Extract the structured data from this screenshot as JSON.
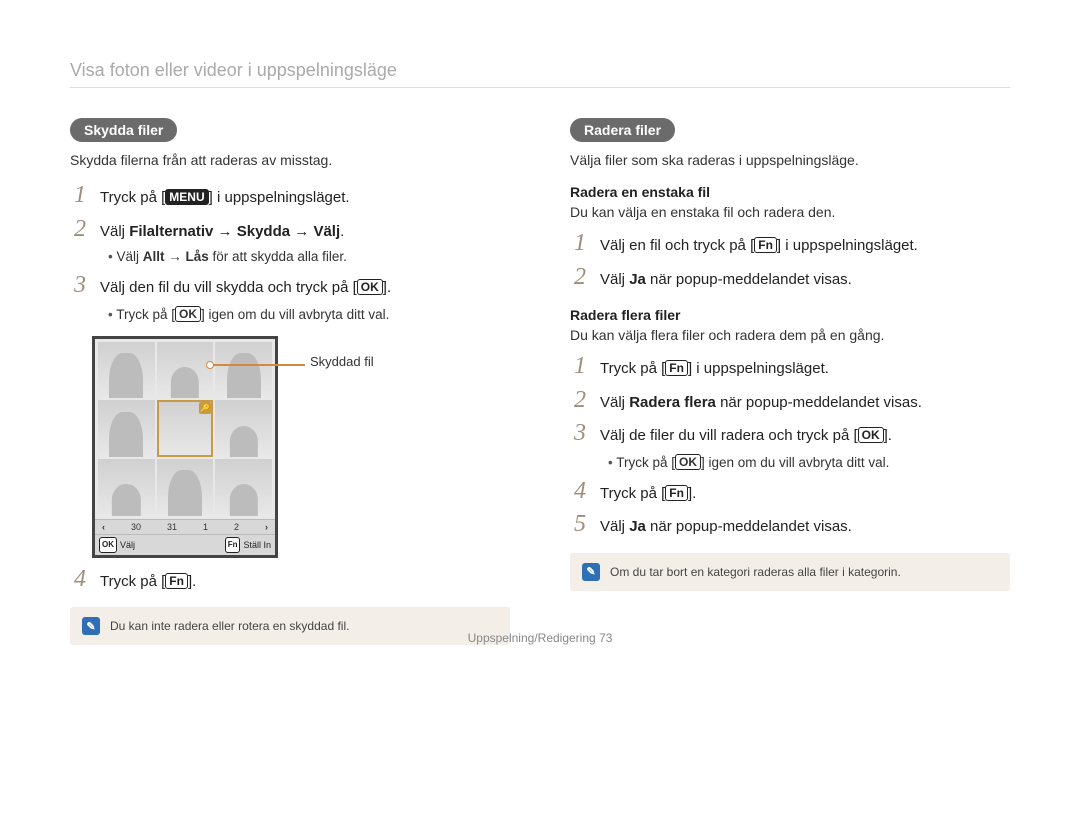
{
  "page": {
    "title": "Visa foton eller videor i uppspelningsläge",
    "footer": "Uppspelning/Redigering  73"
  },
  "badges": {
    "menu": "MENU",
    "ok": "OK",
    "fn": "Fn"
  },
  "left": {
    "pill": "Skydda filer",
    "lead": "Skydda filerna från att raderas av misstag.",
    "steps": {
      "s1a": "Tryck på [",
      "s1b": "] i uppspelningsläget.",
      "s2": "Välj Filalternativ → Skydda → Välj.",
      "s2sub": "Välj Allt → Lås för att skydda alla filer.",
      "s3a": "Välj den fil du vill skydda och tryck på [",
      "s3b": "].",
      "s3sub_a": "Tryck på [",
      "s3sub_b": "] igen om du vill avbryta ditt val.",
      "s4a": "Tryck på [",
      "s4b": "]."
    },
    "illustration": {
      "callout": "Skyddad fil",
      "strip_30": "30",
      "strip_31": "31",
      "strip_1": "1",
      "strip_2": "2",
      "select_label": "Välj",
      "set_label": "Ställ In"
    },
    "note": "Du kan inte radera eller rotera en skyddad fil."
  },
  "right": {
    "pill": "Radera filer",
    "lead": "Välja filer som ska raderas i uppspelningsläge.",
    "single": {
      "head": "Radera en enstaka fil",
      "desc": "Du kan välja en enstaka fil och radera den.",
      "s1a": "Välj en fil och tryck på [",
      "s1b": "] i uppspelningsläget.",
      "s2": "Välj Ja när popup-meddelandet visas."
    },
    "multi": {
      "head": "Radera flera filer",
      "desc": "Du kan välja flera filer och radera dem på en gång.",
      "s1a": "Tryck på [",
      "s1b": "] i uppspelningsläget.",
      "s2": "Välj Radera flera när popup-meddelandet visas.",
      "s3a": "Välj de filer du vill radera och tryck på [",
      "s3b": "].",
      "s3sub_a": "Tryck på [",
      "s3sub_b": "] igen om du vill avbryta ditt val.",
      "s4a": "Tryck på [",
      "s4b": "].",
      "s5": "Välj Ja när popup-meddelandet visas."
    },
    "note": "Om du tar bort en kategori raderas alla filer i kategorin."
  }
}
